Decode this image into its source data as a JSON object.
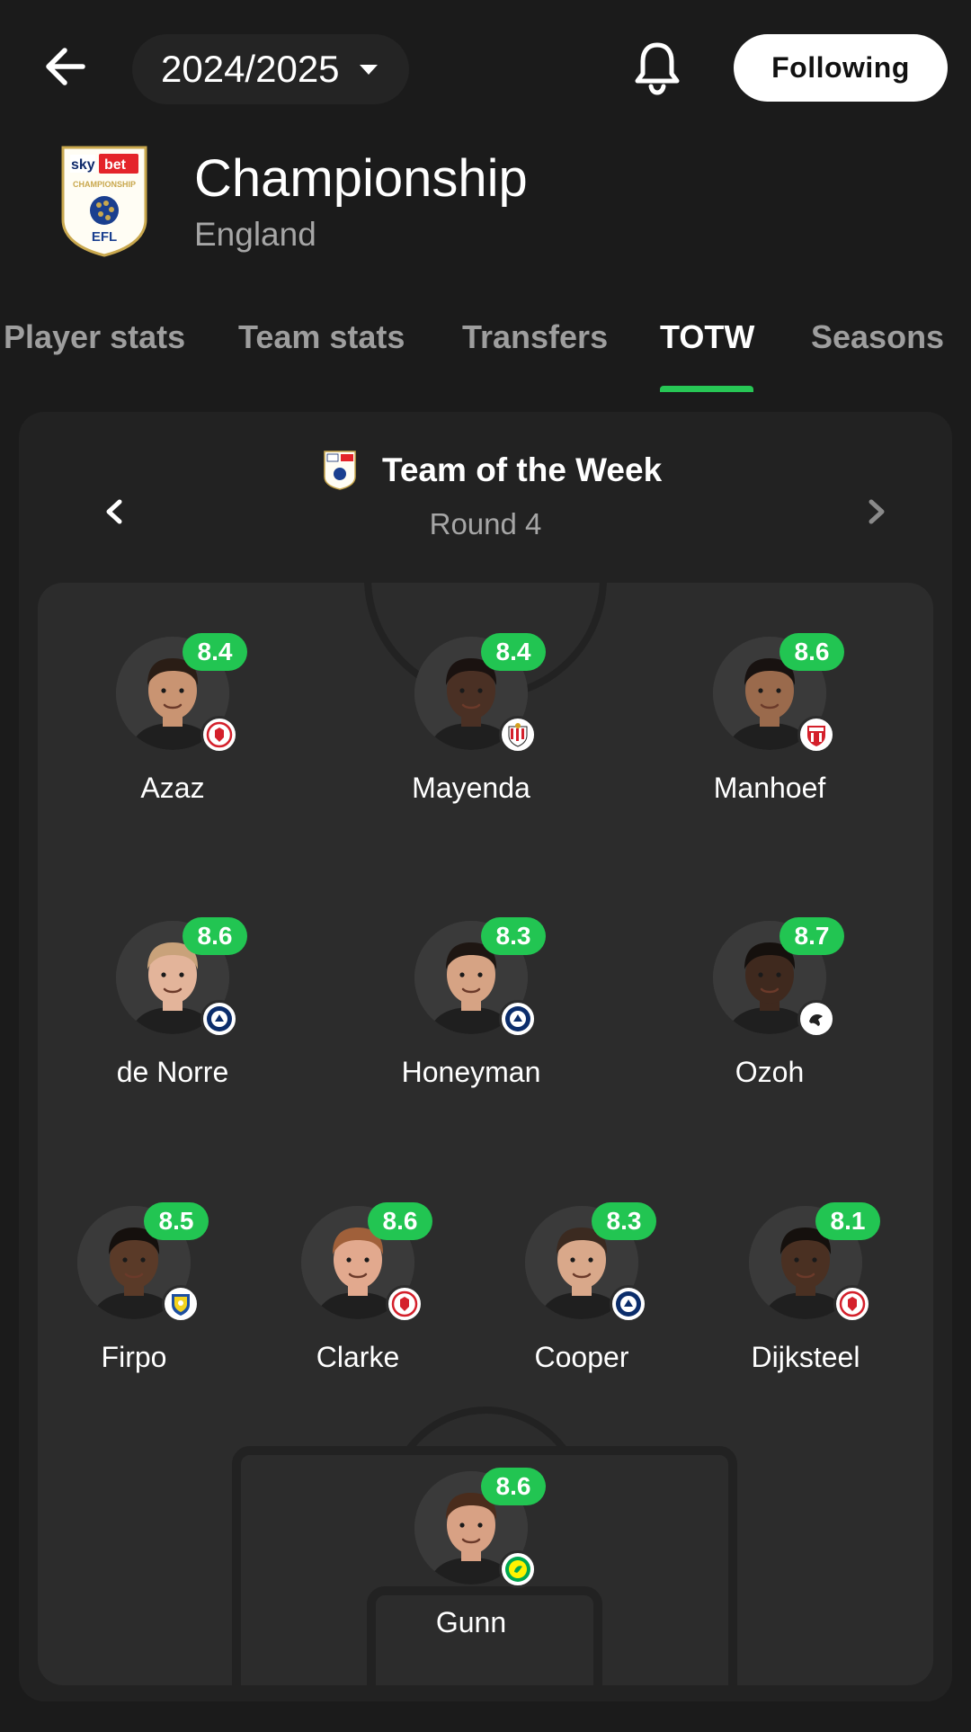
{
  "topbar": {
    "season": "2024/2025",
    "follow_label": "Following"
  },
  "league": {
    "name": "Championship",
    "country": "England",
    "logo_text_top": "sky",
    "logo_text_bet": "bet",
    "logo_text_mid": "CHAMPIONSHIP",
    "logo_text_bottom": "EFL"
  },
  "tabs": [
    {
      "label": "Player stats",
      "active": false
    },
    {
      "label": "Team stats",
      "active": false
    },
    {
      "label": "Transfers",
      "active": false
    },
    {
      "label": "TOTW",
      "active": true
    },
    {
      "label": "Seasons",
      "active": false
    }
  ],
  "totw": {
    "title": "Team of the Week",
    "round": "Round 4"
  },
  "colors": {
    "accent": "#22c552",
    "background": "#1b1b1b",
    "card": "#222222",
    "pitch": "#2c2c2c"
  },
  "players": [
    {
      "name": "Azaz",
      "rating": "8.4",
      "club_icon": "middlesbrough-crest-icon",
      "skin": "#c99472",
      "hair": "#2a1d15"
    },
    {
      "name": "Mayenda",
      "rating": "8.4",
      "club_icon": "sunderland-crest-icon",
      "skin": "#4a3024",
      "hair": "#1a1210"
    },
    {
      "name": "Manhoef",
      "rating": "8.6",
      "club_icon": "stoke-crest-icon",
      "skin": "#9a6a4c",
      "hair": "#181210"
    },
    {
      "name": "de Norre",
      "rating": "8.6",
      "club_icon": "millwall-crest-icon",
      "skin": "#e3b49a",
      "hair": "#c9a27a"
    },
    {
      "name": "Honeyman",
      "rating": "8.3",
      "club_icon": "millwall-crest-icon",
      "skin": "#d6a384",
      "hair": "#1e1612"
    },
    {
      "name": "Ozoh",
      "rating": "8.7",
      "club_icon": "derby-crest-icon",
      "skin": "#3f291e",
      "hair": "#15100d"
    },
    {
      "name": "Firpo",
      "rating": "8.5",
      "club_icon": "leeds-crest-icon",
      "skin": "#5a3a28",
      "hair": "#15100d"
    },
    {
      "name": "Clarke",
      "rating": "8.6",
      "club_icon": "middlesbrough-crest-icon",
      "skin": "#e2a98e",
      "hair": "#a0603a"
    },
    {
      "name": "Cooper",
      "rating": "8.3",
      "club_icon": "millwall-crest-icon",
      "skin": "#d9a88a",
      "hair": "#3b2a20"
    },
    {
      "name": "Dijksteel",
      "rating": "8.1",
      "club_icon": "middlesbrough-crest-icon",
      "skin": "#4a3022",
      "hair": "#15100d"
    },
    {
      "name": "Gunn",
      "rating": "8.6",
      "club_icon": "norwich-crest-icon",
      "skin": "#d8a184",
      "hair": "#4a2c1c"
    }
  ]
}
